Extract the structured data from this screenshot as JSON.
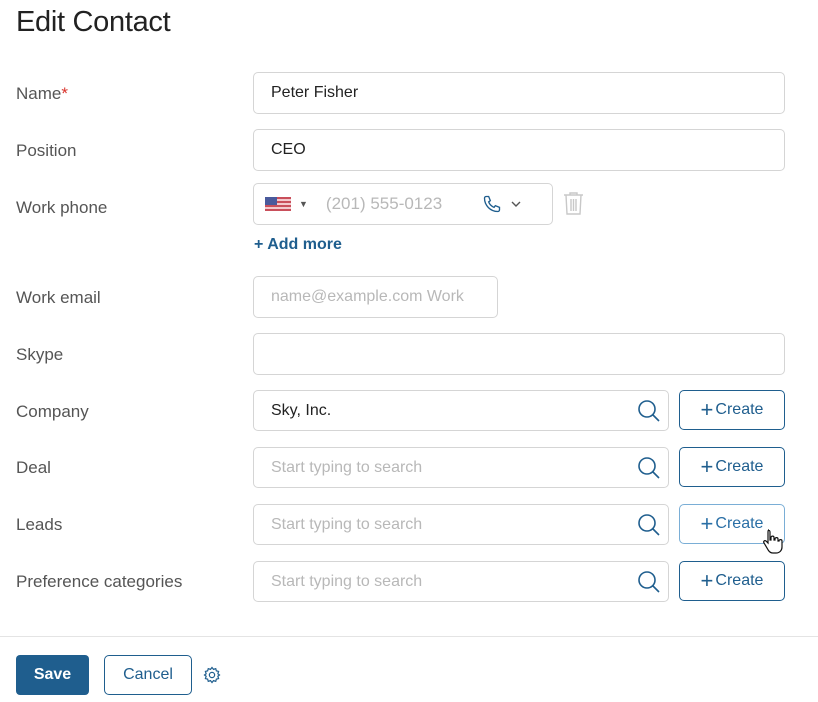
{
  "header": {
    "title": "Edit Contact"
  },
  "fields": {
    "name": {
      "label": "Name",
      "required_mark": "*",
      "value": "Peter Fisher"
    },
    "position": {
      "label": "Position",
      "value": "CEO"
    },
    "work_phone": {
      "label": "Work phone",
      "country": "US",
      "placeholder": "(201) 555-0123",
      "add_more": "+ Add more"
    },
    "work_email": {
      "label": "Work email",
      "placeholder": "name@example.com Work"
    },
    "skype": {
      "label": "Skype",
      "value": ""
    },
    "company": {
      "label": "Company",
      "value": "Sky, Inc.",
      "create": "Create"
    },
    "deal": {
      "label": "Deal",
      "placeholder": "Start typing to search",
      "create": "Create"
    },
    "leads": {
      "label": "Leads",
      "placeholder": "Start typing to search",
      "create": "Create"
    },
    "preference_categories": {
      "label": "Preference categories",
      "placeholder": "Start typing to search",
      "create": "Create"
    }
  },
  "footer": {
    "save": "Save",
    "cancel": "Cancel"
  },
  "colors": {
    "accent": "#1f5e8e",
    "required": "#d9322b"
  }
}
